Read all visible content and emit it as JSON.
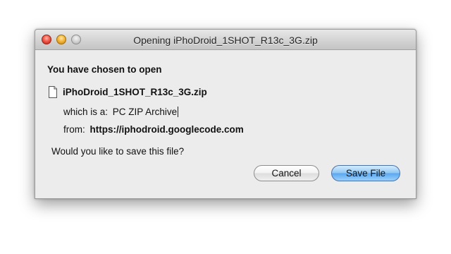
{
  "window": {
    "title": "Opening iPhoDroid_1SHOT_R13c_3G.zip"
  },
  "dialog": {
    "heading": "You have chosen to open",
    "file_name": "iPhoDroid_1SHOT_R13c_3G.zip",
    "file_icon": "document-icon",
    "type_label": "which is a:",
    "type_value": "PC ZIP Archive",
    "from_label": "from:",
    "from_value": "https://iphodroid.googlecode.com",
    "question": "Would you like to save this file?"
  },
  "buttons": {
    "cancel_label": "Cancel",
    "save_label": "Save File"
  },
  "colors": {
    "close": "#f05a4a",
    "minimize": "#f5b73c",
    "zoom": "#cfcfcf",
    "default_button": "#5aa6ef",
    "window_background": "#ececec"
  }
}
